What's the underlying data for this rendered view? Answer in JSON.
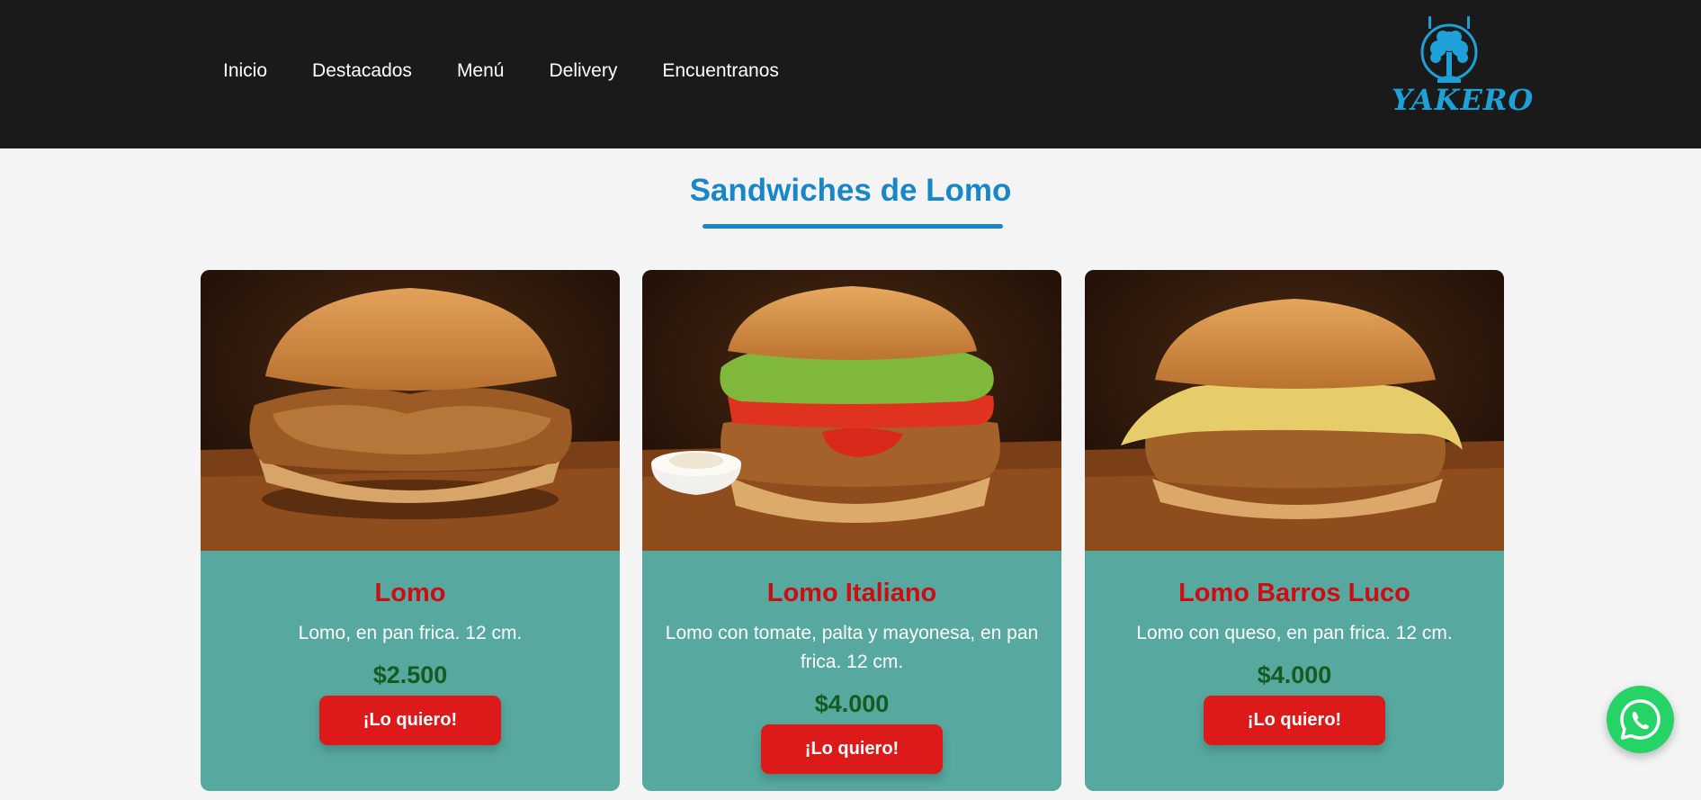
{
  "nav": {
    "items": [
      {
        "label": "Inicio"
      },
      {
        "label": "Destacados"
      },
      {
        "label": "Menú"
      },
      {
        "label": "Delivery"
      },
      {
        "label": "Encuentranos"
      }
    ]
  },
  "logo": {
    "text": "YAKERO",
    "icon": "tree-utensils-icon"
  },
  "section": {
    "title": "Sandwiches de Lomo"
  },
  "products": [
    {
      "name": "Lomo",
      "description": "Lomo, en pan frica. 12 cm.",
      "price": "$2.500",
      "button": "¡Lo quiero!",
      "image": "sandwich-lomo-image"
    },
    {
      "name": "Lomo Italiano",
      "description": "Lomo con tomate, palta y mayonesa, en pan frica. 12 cm.",
      "price": "$4.000",
      "button": "¡Lo quiero!",
      "image": "sandwich-lomo-italiano-image"
    },
    {
      "name": "Lomo Barros Luco",
      "description": "Lomo con queso, en pan frica. 12 cm.",
      "price": "$4.000",
      "button": "¡Lo quiero!",
      "image": "sandwich-lomo-barros-luco-image"
    }
  ],
  "colors": {
    "header_bg": "#1a1a1a",
    "accent_blue": "#1987c7",
    "card_bg": "#57a89f",
    "name_red": "#cc0e12",
    "price_green": "#155c23",
    "button_red": "#dc1a1a",
    "whatsapp_green": "#25d366"
  },
  "whatsapp": {
    "icon": "whatsapp-icon"
  }
}
